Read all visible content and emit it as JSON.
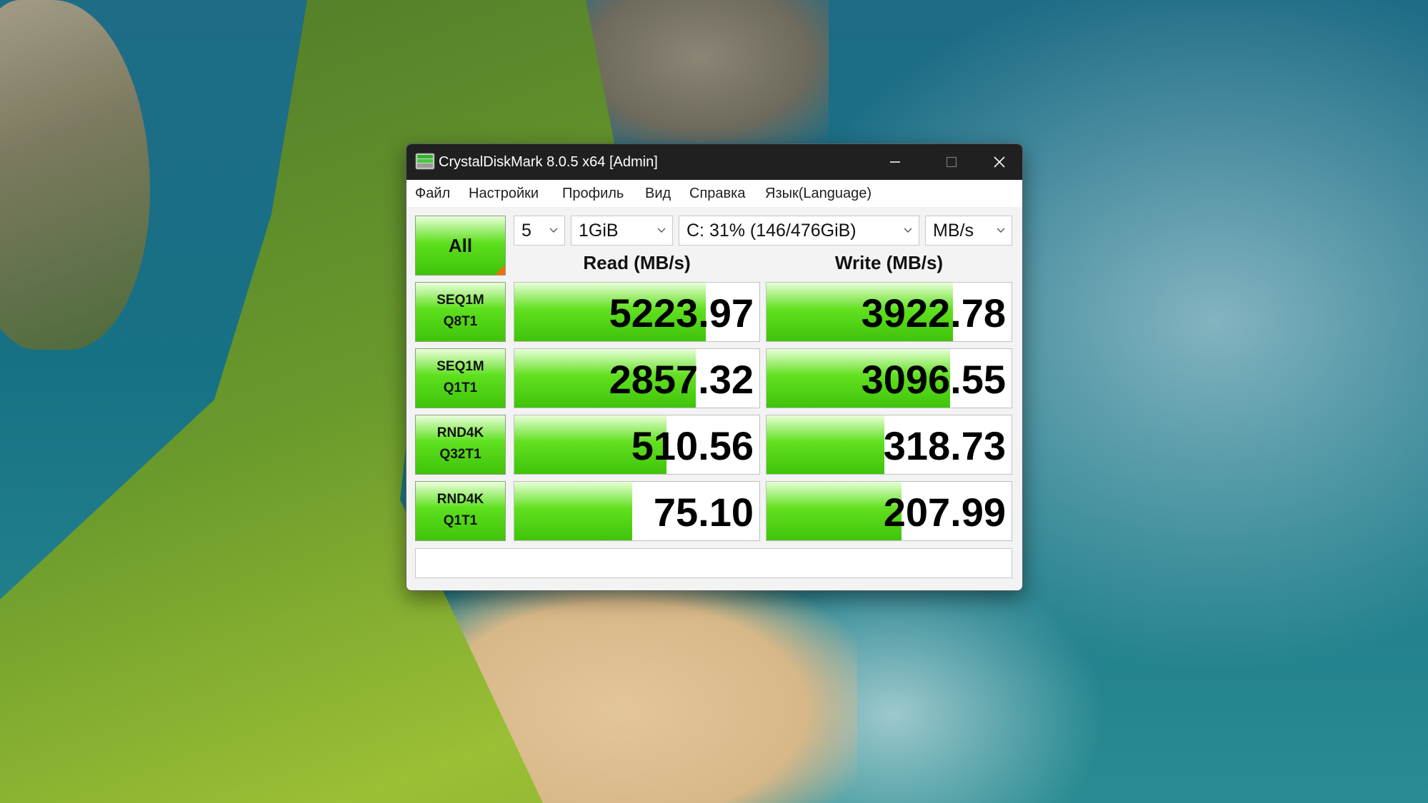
{
  "window": {
    "title": "CrystalDiskMark 8.0.5 x64 [Admin]"
  },
  "menu": [
    "Файл",
    "Настройки",
    "Профиль",
    "Вид",
    "Справка",
    "Язык(Language)"
  ],
  "toolbar": {
    "all_label": "All",
    "count": "5",
    "size": "1GiB",
    "drive": "C: 31% (146/476GiB)",
    "unit": "MB/s"
  },
  "headers": {
    "read": "Read (MB/s)",
    "write": "Write (MB/s)"
  },
  "rows": [
    {
      "line1": "SEQ1M",
      "line2": "Q8T1",
      "read": "5223.97",
      "write": "3922.78",
      "read_fill": 0.78,
      "write_fill": 0.76
    },
    {
      "line1": "SEQ1M",
      "line2": "Q1T1",
      "read": "2857.32",
      "write": "3096.55",
      "read_fill": 0.74,
      "write_fill": 0.75
    },
    {
      "line1": "RND4K",
      "line2": "Q32T1",
      "read": "510.56",
      "write": "318.73",
      "read_fill": 0.62,
      "write_fill": 0.48
    },
    {
      "line1": "RND4K",
      "line2": "Q1T1",
      "read": "75.10",
      "write": "207.99",
      "read_fill": 0.48,
      "write_fill": 0.55
    }
  ],
  "comment": "",
  "colors": {
    "titlebar": "#202020",
    "bar_green": "#3fc40a",
    "all_corner": "#f36f12"
  }
}
